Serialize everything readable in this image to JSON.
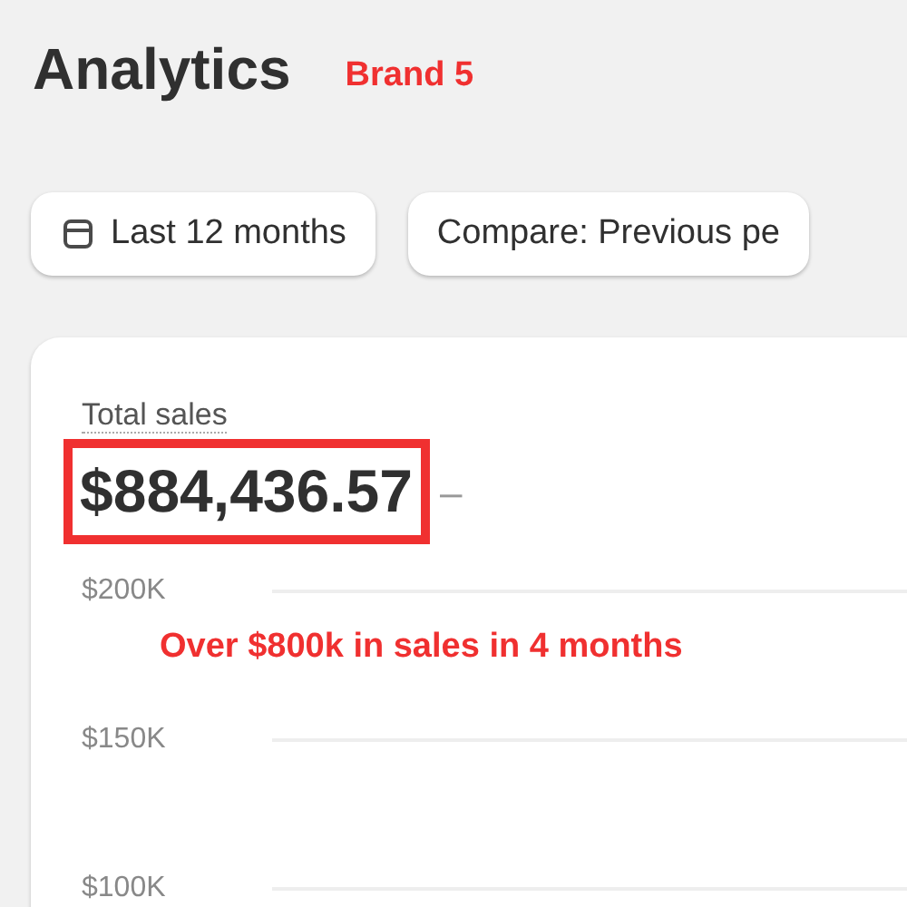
{
  "page": {
    "title": "Analytics"
  },
  "annotations": [
    {
      "kind": "label",
      "text": "Brand 5"
    },
    {
      "kind": "label",
      "text": "Over $800k in sales in 4 months"
    }
  ],
  "filters": [
    {
      "kind": "date",
      "label": "Last 12 months"
    },
    {
      "kind": "plain",
      "label": "Compare: Previous pe"
    }
  ],
  "card": {
    "title": "Total sales",
    "value": "$884,436.57",
    "highlighted": true,
    "trend": "–",
    "y_axis_labels": [
      "$200K",
      "$150K",
      "$100K"
    ]
  }
}
